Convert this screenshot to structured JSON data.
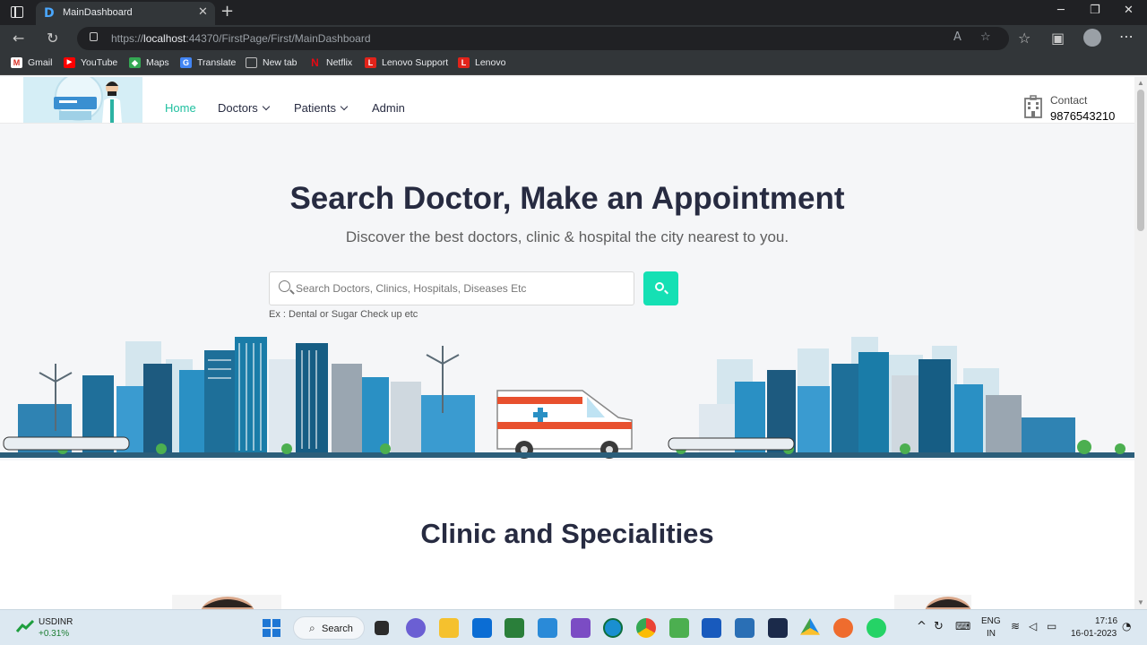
{
  "browser": {
    "tab_title": "MainDashboard",
    "tab_favicon": "D",
    "url_prefix": "https://",
    "url_host": "localhost",
    "url_rest": ":44370/FirstPage/First/MainDashboard",
    "bookmarks": [
      {
        "label": "Gmail",
        "icon": "gmail-icon",
        "color": "#d93025",
        "glyph": "M"
      },
      {
        "label": "YouTube",
        "icon": "youtube-icon",
        "color": "#ff0000",
        "glyph": "▶"
      },
      {
        "label": "Maps",
        "icon": "maps-icon",
        "color": "#34a853",
        "glyph": "◆"
      },
      {
        "label": "Translate",
        "icon": "translate-icon",
        "color": "#4285f4",
        "glyph": "G"
      },
      {
        "label": "New tab",
        "icon": "newtab-icon",
        "color": "#5f6368",
        "glyph": "□"
      },
      {
        "label": "Netflix",
        "icon": "netflix-icon",
        "color": "#b20710",
        "glyph": "N"
      },
      {
        "label": "Lenovo Support",
        "icon": "lenovo-icon",
        "color": "#e2231a",
        "glyph": "L"
      },
      {
        "label": "Lenovo",
        "icon": "lenovo-icon",
        "color": "#e2231a",
        "glyph": "L"
      }
    ]
  },
  "header": {
    "nav": [
      {
        "label": "Home",
        "active": true
      },
      {
        "label": "Doctors",
        "dropdown": true
      },
      {
        "label": "Patients",
        "dropdown": true
      },
      {
        "label": "Admin"
      }
    ],
    "contact_label": "Contact",
    "contact_phone": "9876543210"
  },
  "hero": {
    "title": "Search Doctor, Make an Appointment",
    "subtitle": "Discover the best doctors, clinic & hospital the city nearest to you.",
    "search_placeholder": "Search Doctors, Clinics, Hospitals, Diseases Etc",
    "search_hint": "Ex : Dental or Sugar Check up etc"
  },
  "section": {
    "title": "Clinic and Specialities"
  },
  "taskbar": {
    "ticker_name": "USDINR",
    "ticker_change": "+0.31%",
    "search_label": "Search",
    "lang_1": "ENG",
    "lang_2": "IN",
    "time": "17:16",
    "date": "16-01-2023"
  },
  "colors": {
    "accent": "#15e0b4",
    "nav_active": "#20c0a0",
    "heading": "#272b41"
  }
}
